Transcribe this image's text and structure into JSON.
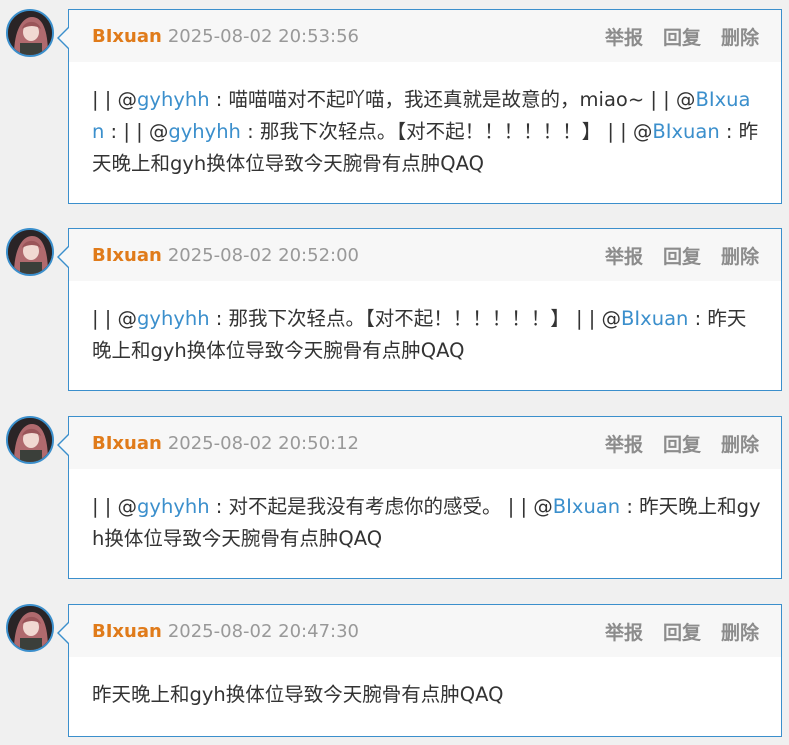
{
  "actions": {
    "report": "举报",
    "reply": "回复",
    "delete": "删除"
  },
  "colors": {
    "username": "#e07b1a",
    "mention": "#3b8fcc",
    "border": "#3b8fcc",
    "timestamp": "#999999",
    "action": "#8c8c8c"
  },
  "comments": [
    {
      "user": "BIxuan",
      "time": "2025-08-02 20:53:56",
      "segments": [
        {
          "t": "text",
          "v": "| | @"
        },
        {
          "t": "mention",
          "v": "gyhyhh"
        },
        {
          "t": "text",
          "v": " : 喵喵喵对不起吖喵，我还真就是故意的，miao~ | | @"
        },
        {
          "t": "mention",
          "v": "BIxuan"
        },
        {
          "t": "text",
          "v": " : | | @"
        },
        {
          "t": "mention",
          "v": "gyhyhh"
        },
        {
          "t": "text",
          "v": " : 那我下次轻点。【对不起！！！！！！】 | | @"
        },
        {
          "t": "mention",
          "v": "BIxuan"
        },
        {
          "t": "text",
          "v": " : 昨天晚上和gyh换体位导致今天腕骨有点肿QAQ"
        }
      ]
    },
    {
      "user": "BIxuan",
      "time": "2025-08-02 20:52:00",
      "segments": [
        {
          "t": "text",
          "v": "| | @"
        },
        {
          "t": "mention",
          "v": "gyhyhh"
        },
        {
          "t": "text",
          "v": " : 那我下次轻点。【对不起！！！！！！】 | | @"
        },
        {
          "t": "mention",
          "v": "BIxuan"
        },
        {
          "t": "text",
          "v": " : 昨天晚上和gyh换体位导致今天腕骨有点肿QAQ"
        }
      ]
    },
    {
      "user": "BIxuan",
      "time": "2025-08-02 20:50:12",
      "segments": [
        {
          "t": "text",
          "v": "| | @"
        },
        {
          "t": "mention",
          "v": "gyhyhh"
        },
        {
          "t": "text",
          "v": " : 对不起是我没有考虑你的感受。 | | @"
        },
        {
          "t": "mention",
          "v": "BIxuan"
        },
        {
          "t": "text",
          "v": " : 昨天晚上和gyh换体位导致今天腕骨有点肿QAQ"
        }
      ]
    },
    {
      "user": "BIxuan",
      "time": "2025-08-02 20:47:30",
      "segments": [
        {
          "t": "text",
          "v": "昨天晚上和gyh换体位导致今天腕骨有点肿QAQ"
        }
      ]
    }
  ]
}
